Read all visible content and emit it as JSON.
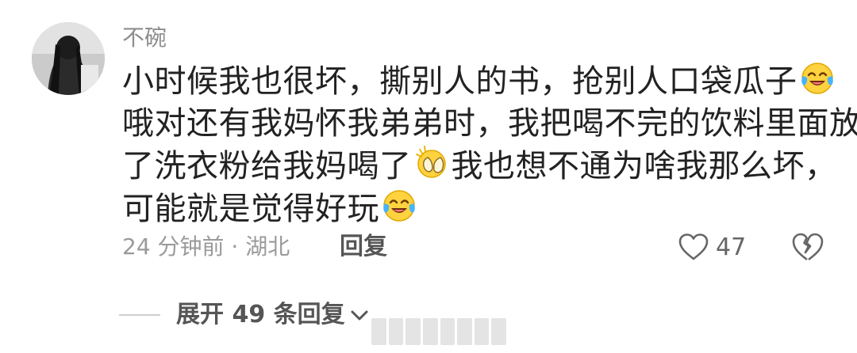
{
  "comment": {
    "username": "不碗",
    "lines": [
      {
        "before": "小时候我也很坏，撕别人的书，抢别人口袋瓜子",
        "emoji": "laugh-cry-emoji",
        "after": ""
      },
      {
        "before": "哦对还有我妈怀我弟弟时，我把喝不完的饮料里面放",
        "emoji": "",
        "after": ""
      },
      {
        "before": "了洗衣粉给我妈喝了",
        "emoji": "hands-over-face-emoji",
        "after": "我也想不通为啥我那么坏，"
      },
      {
        "before": "可能就是觉得好玩",
        "emoji": "laugh-cry-emoji",
        "after": ""
      }
    ],
    "meta": "24 分钟前 · 湖北",
    "reply_label": "回复",
    "like_count": "47"
  },
  "expand": {
    "label": "展开 49 条回复"
  },
  "colors": {
    "text": "#222222",
    "meta": "#9a9a9a",
    "action": "#555555"
  }
}
